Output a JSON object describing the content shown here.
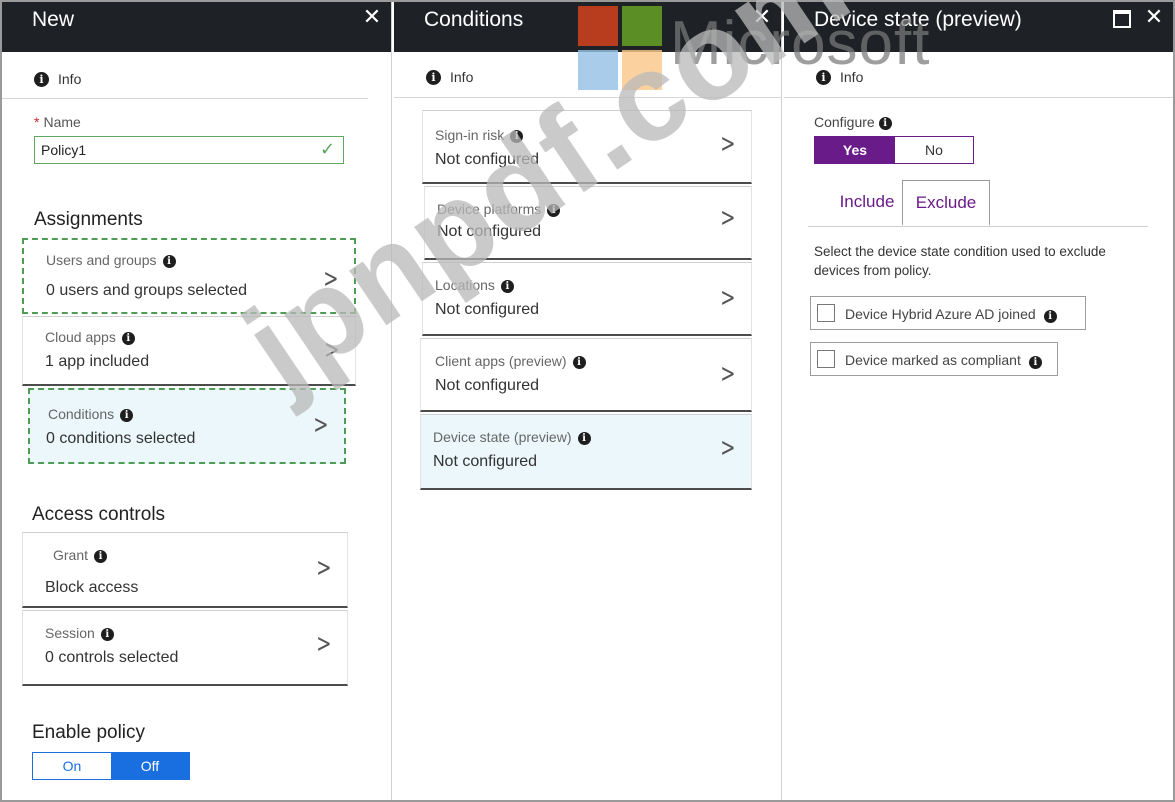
{
  "blades": {
    "new": {
      "title": "New",
      "info": "Info",
      "name_label": "Name",
      "name_value": "Policy1",
      "assignments_title": "Assignments",
      "assignments": [
        {
          "label": "Users and groups",
          "value": "0 users and groups selected"
        },
        {
          "label": "Cloud apps",
          "value": "1 app included"
        },
        {
          "label": "Conditions",
          "value": "0  conditions  selected"
        }
      ],
      "access_controls_title": "Access controls",
      "access_controls": [
        {
          "label": "Grant",
          "value": "Block access"
        },
        {
          "label": "Session",
          "value": "0 controls selected"
        }
      ],
      "enable_policy_title": "Enable policy",
      "enable_on": "On",
      "enable_off": "Off"
    },
    "conditions": {
      "title": "Conditions",
      "info": "Info",
      "items": [
        {
          "label": "Sign-in risk",
          "value": "Not configured"
        },
        {
          "label": "Device platforms",
          "value": "Not configured"
        },
        {
          "label": "Locations",
          "value": "Not configured"
        },
        {
          "label": "Client apps (preview)",
          "value": "Not configured"
        },
        {
          "label": "Device state (preview)",
          "value": "Not configured"
        }
      ]
    },
    "device_state": {
      "title": "Device state (preview)",
      "info": "Info",
      "configure_label": "Configure",
      "configure_yes": "Yes",
      "configure_no": "No",
      "tab_include": "Include",
      "tab_exclude": "Exclude",
      "description": "Select the device state condition used to exclude devices from policy.",
      "options": [
        {
          "label": "Device Hybrid Azure AD joined"
        },
        {
          "label": "Device marked as compliant"
        }
      ]
    }
  },
  "overlay": {
    "brand_text": "Microsoft",
    "watermark": "jpnpdf.com"
  },
  "colors": {
    "header_bg": "#1e2126",
    "accent_purple": "#6a1b8a",
    "toggle_blue": "#1a6fe0",
    "selected_bg": "#ebf7fb",
    "dash_green": "#4f9d55",
    "ms_red": "#d9441d",
    "ms_green": "#6aa626",
    "ms_blue": "#96c2e6",
    "ms_yellow": "#fbc98a"
  }
}
